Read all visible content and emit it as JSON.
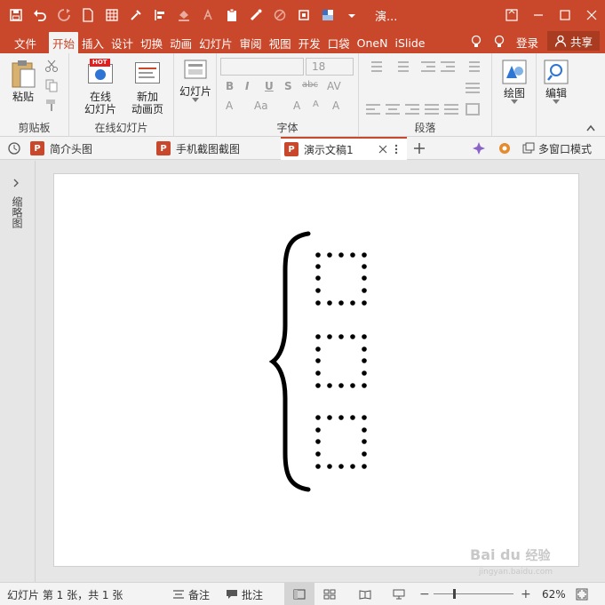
{
  "title_bar": {
    "title": "演...",
    "colors": {
      "accent": "#c9472a"
    }
  },
  "tabs": {
    "file": "文件",
    "home": "开始",
    "insert": "插入",
    "design": "设计",
    "transitions": "切换",
    "animations": "动画",
    "slideshow": "幻灯片",
    "review": "审阅",
    "view": "视图",
    "developer": "开发",
    "pocket": "口袋",
    "onenote": "OneN",
    "islide": "iSlide",
    "login": "登录",
    "share": "共享"
  },
  "ribbon": {
    "clipboard": {
      "label": "剪贴板",
      "paste": "粘贴"
    },
    "online": {
      "label": "在线幻灯片",
      "online_slide": "在线\n幻灯片",
      "new_anim": "新加\n动画页",
      "hot": "HOT"
    },
    "slides": {
      "label": "幻灯片"
    },
    "font": {
      "label": "字体",
      "font_size": "18"
    },
    "paragraph": {
      "label": "段落"
    },
    "drawing": {
      "label": "绘图"
    },
    "editing": {
      "label": "编辑"
    }
  },
  "doc_tabs": {
    "tab1": "简介头图",
    "tab2": "手机截图截图",
    "tab3": "演示文稿1",
    "multi_window": "多窗口模式",
    "pin_glyph": "P"
  },
  "sidebar": {
    "label": "缩略图"
  },
  "statusbar": {
    "slide_info": "幻灯片 第 1 张，共 1 张",
    "notes": "备注",
    "comments": "批注",
    "zoom": "62%"
  },
  "watermark": {
    "brand": "Bai du",
    "sub": "经验",
    "url": "jingyan.baidu.com"
  }
}
